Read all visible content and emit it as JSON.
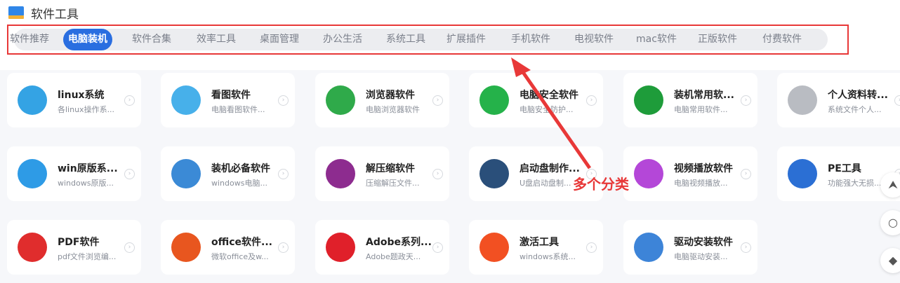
{
  "header": {
    "title": "软件工具"
  },
  "tabs": [
    {
      "label": "软件推荐",
      "active": false
    },
    {
      "label": "电脑装机",
      "active": true
    },
    {
      "label": "软件合集",
      "active": false
    },
    {
      "label": "效率工具",
      "active": false
    },
    {
      "label": "桌面管理",
      "active": false
    },
    {
      "label": "办公生活",
      "active": false
    },
    {
      "label": "系统工具",
      "active": false
    },
    {
      "label": "扩展插件",
      "active": false
    },
    {
      "label": "手机软件",
      "active": false
    },
    {
      "label": "电视软件",
      "active": false
    },
    {
      "label": "mac软件",
      "active": false
    },
    {
      "label": "正版软件",
      "active": false
    },
    {
      "label": "付费软件",
      "active": false
    }
  ],
  "cards": [
    {
      "name": "linux系统",
      "desc": "各linux操作系...",
      "icon": "penguin-icon",
      "color": "#34a3e4"
    },
    {
      "name": "看图软件",
      "desc": "电脑看图软件...",
      "icon": "picture-icon",
      "color": "#47b0ea"
    },
    {
      "name": "浏览器软件",
      "desc": "电脑浏览器软件",
      "icon": "browser-e-icon",
      "color": "#2faa4a"
    },
    {
      "name": "电脑安全软件",
      "desc": "电脑安全防护...",
      "icon": "security-plus-icon",
      "color": "#25b24a"
    },
    {
      "name": "装机常用软...",
      "desc": "电脑常用软件...",
      "icon": "shield-check-icon",
      "color": "#1e9c3a"
    },
    {
      "name": "个人资料转...",
      "desc": "系统文件个人...",
      "icon": "user-add-icon",
      "color": "#b9bcc2"
    },
    {
      "name": "win原版系...",
      "desc": "windows原版...",
      "icon": "windows-icon",
      "color": "#2e9be6"
    },
    {
      "name": "装机必备软件",
      "desc": "windows电脑...",
      "icon": "monitor-icon",
      "color": "#3b8ad6"
    },
    {
      "name": "解压缩软件",
      "desc": "压缩解压文件...",
      "icon": "archive-icon",
      "color": "#8d2c8f"
    },
    {
      "name": "启动盘制作...",
      "desc": "U盘启动盘制...",
      "icon": "usb-drive-icon",
      "color": "#2a4f7a"
    },
    {
      "name": "视频播放软件",
      "desc": "电脑视频播放...",
      "icon": "play-icon",
      "color": "#b447d8"
    },
    {
      "name": "PE工具",
      "desc": "功能强大无损...",
      "icon": "usb-stick-icon",
      "color": "#2b6fd4"
    },
    {
      "name": "PDF软件",
      "desc": "pdf文件浏览编...",
      "icon": "pdf-icon",
      "color": "#e02d2d"
    },
    {
      "name": "office软件...",
      "desc": "微软office及w...",
      "icon": "office-icon",
      "color": "#e8561f"
    },
    {
      "name": "Adobe系列...",
      "desc": "Adobe题政天...",
      "icon": "adobe-icon",
      "color": "#e0202a"
    },
    {
      "name": "激活工具",
      "desc": "windows系统...",
      "icon": "windows-color-icon",
      "color": "#f25022"
    },
    {
      "name": "驱动安装软件",
      "desc": "电脑驱动安装...",
      "icon": "driver-icon",
      "color": "#3d84d8"
    }
  ],
  "annotation": {
    "label": "多个分类"
  },
  "side_buttons": [
    {
      "icon": "arrow-up-icon",
      "glyph": "⮝"
    },
    {
      "icon": "search-icon",
      "glyph": "○"
    },
    {
      "icon": "tag-icon",
      "glyph": "◆"
    }
  ]
}
